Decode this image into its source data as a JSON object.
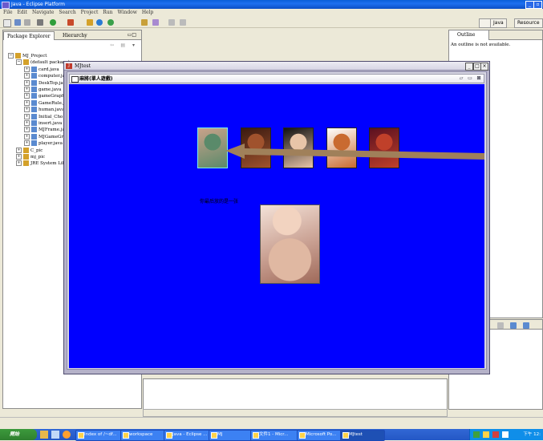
{
  "eclipse": {
    "title": "Java - Eclipse Platform",
    "menu": [
      "File",
      "Edit",
      "Navigate",
      "Search",
      "Project",
      "Run",
      "Window",
      "Help"
    ],
    "perspectives": [
      "Java",
      "Resource"
    ]
  },
  "package_explorer": {
    "tabs": [
      "Package Explorer",
      "Hierarchy"
    ],
    "tree": [
      {
        "label": "MJ_Project",
        "indent": 0
      },
      {
        "label": "(default package)",
        "indent": 1
      },
      {
        "label": "card.java",
        "indent": 2
      },
      {
        "label": "computer.java",
        "indent": 2
      },
      {
        "label": "DeskTop.java",
        "indent": 2
      },
      {
        "label": "game.java",
        "indent": 2
      },
      {
        "label": "gameGraph",
        "indent": 2
      },
      {
        "label": "GameRule.java",
        "indent": 2
      },
      {
        "label": "human.java",
        "indent": 2
      },
      {
        "label": "Initial_Cho",
        "indent": 2
      },
      {
        "label": "insert.java",
        "indent": 2
      },
      {
        "label": "MJFrame.java",
        "indent": 2
      },
      {
        "label": "MJGameGr",
        "indent": 2
      },
      {
        "label": "player.java",
        "indent": 2
      },
      {
        "label": "C_pic",
        "indent": 1
      },
      {
        "label": "mj_pic",
        "indent": 1
      },
      {
        "label": "JRE System Library",
        "indent": 1
      }
    ]
  },
  "outline": {
    "tab": "Outline",
    "message": "An outline is not available."
  },
  "mj_window": {
    "title": "MJtest",
    "frame_title": "麻將(單人遊戲)",
    "message": "你最后放的是一张",
    "cards": [
      {
        "label": "card-1",
        "color_a": "#c9a28a",
        "color_b": "#5a8a6a"
      },
      {
        "label": "card-2",
        "color_a": "#3a1a10",
        "color_b": "#a0522d"
      },
      {
        "label": "card-3",
        "color_a": "#111111",
        "color_b": "#e8c4a8"
      },
      {
        "label": "card-4",
        "color_a": "#ffffff",
        "color_b": "#c96a30"
      },
      {
        "label": "card-5",
        "color_a": "#5a1020",
        "color_b": "#c0402a"
      }
    ]
  },
  "taskbar": {
    "start": "開始",
    "tasks": [
      "Index of /~df...",
      "workspace",
      "Java - Eclipse ...",
      "MJ",
      "文件1 - Micr...",
      "Microsoft Po...",
      "MJtest"
    ],
    "clock": "下午 12:"
  }
}
